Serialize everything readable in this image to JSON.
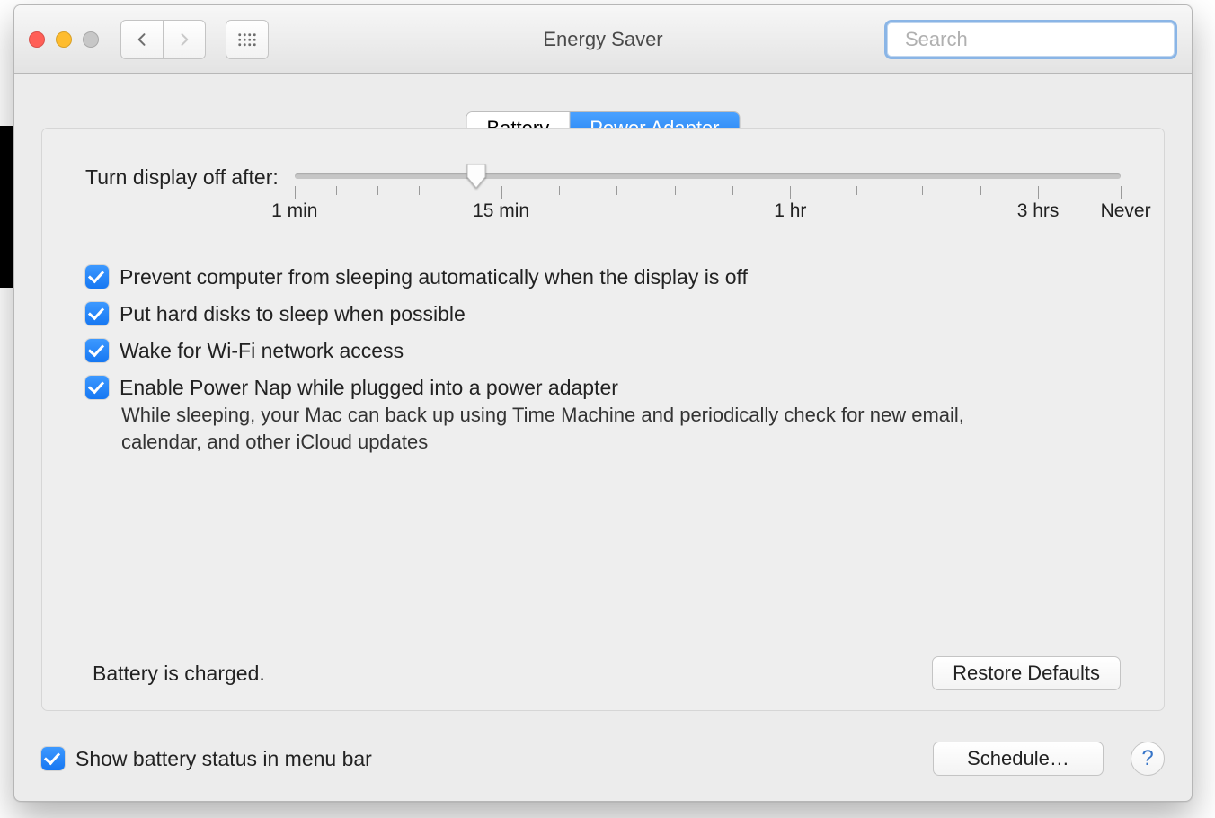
{
  "window": {
    "title": "Energy Saver"
  },
  "search": {
    "placeholder": "Search",
    "value": ""
  },
  "tabs": {
    "battery": "Battery",
    "power_adapter": "Power Adapter",
    "active": "power_adapter"
  },
  "slider": {
    "label": "Turn display off after:",
    "value_percent": 22,
    "labels": {
      "one_min": "1 min",
      "fifteen_min": "15 min",
      "one_hr": "1 hr",
      "three_hrs": "3 hrs",
      "never": "Never"
    }
  },
  "options": {
    "prevent_sleep": {
      "label": "Prevent computer from sleeping automatically when the display is off",
      "checked": true
    },
    "disk_sleep": {
      "label": "Put hard disks to sleep when possible",
      "checked": true
    },
    "wake_wifi": {
      "label": "Wake for Wi-Fi network access",
      "checked": true
    },
    "power_nap": {
      "label": "Enable Power Nap while plugged into a power adapter",
      "checked": true,
      "subtext": "While sleeping, your Mac can back up using Time Machine and periodically check for new email, calendar, and other iCloud updates"
    }
  },
  "status": {
    "battery": "Battery is charged."
  },
  "buttons": {
    "restore_defaults": "Restore Defaults",
    "schedule": "Schedule…",
    "help": "?"
  },
  "footer_option": {
    "label": "Show battery status in menu bar",
    "checked": true
  }
}
